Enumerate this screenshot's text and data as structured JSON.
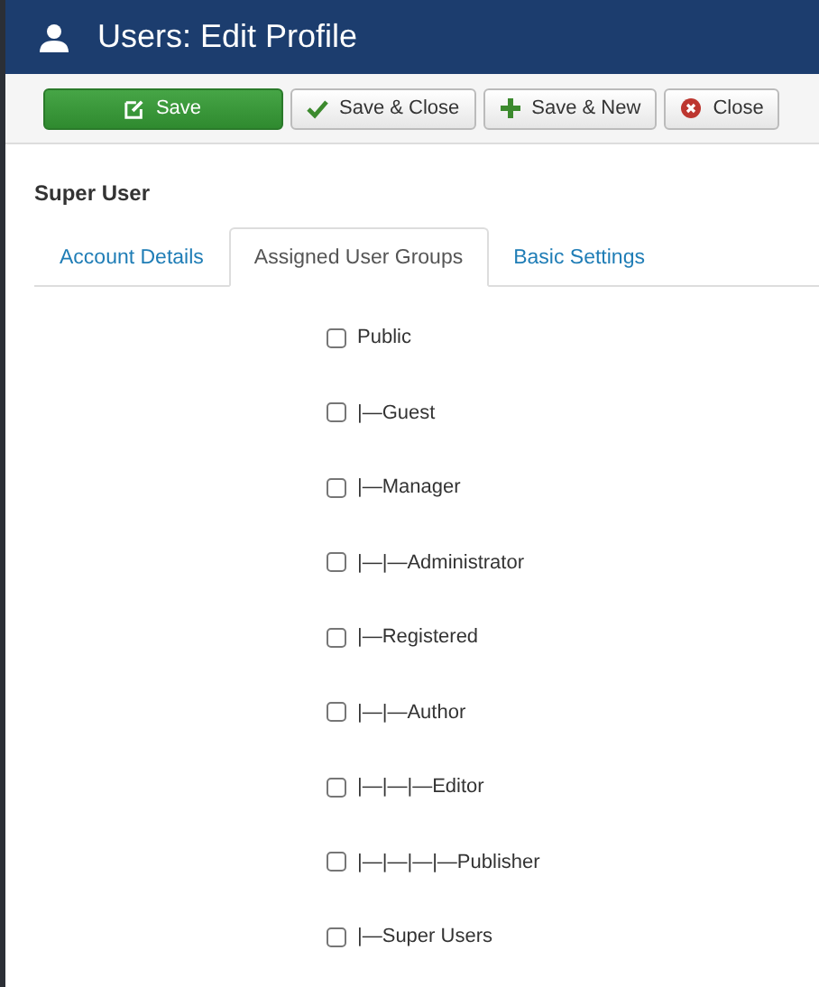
{
  "header": {
    "title": "Users: Edit Profile"
  },
  "toolbar": [
    {
      "kind": "save",
      "label": "Save"
    },
    {
      "kind": "check",
      "label": "Save & Close"
    },
    {
      "kind": "plus",
      "label": "Save & New"
    },
    {
      "kind": "close",
      "label": "Close"
    }
  ],
  "user_name": "Super User",
  "tabs": [
    {
      "label": "Account Details",
      "selected": false
    },
    {
      "label": "Assigned User Groups",
      "selected": true
    },
    {
      "label": "Basic Settings",
      "selected": false
    }
  ],
  "groups": [
    {
      "label": "Public",
      "checked": false
    },
    {
      "label": "|—Guest",
      "checked": false
    },
    {
      "label": "|—Manager",
      "checked": false
    },
    {
      "label": "|—|—Administrator",
      "checked": false
    },
    {
      "label": "|—Registered",
      "checked": false
    },
    {
      "label": "|—|—Author",
      "checked": false
    },
    {
      "label": "|—|—|—Editor",
      "checked": false
    },
    {
      "label": "|—|—|—|—Publisher",
      "checked": false
    },
    {
      "label": "|—Super Users",
      "checked": false
    }
  ]
}
